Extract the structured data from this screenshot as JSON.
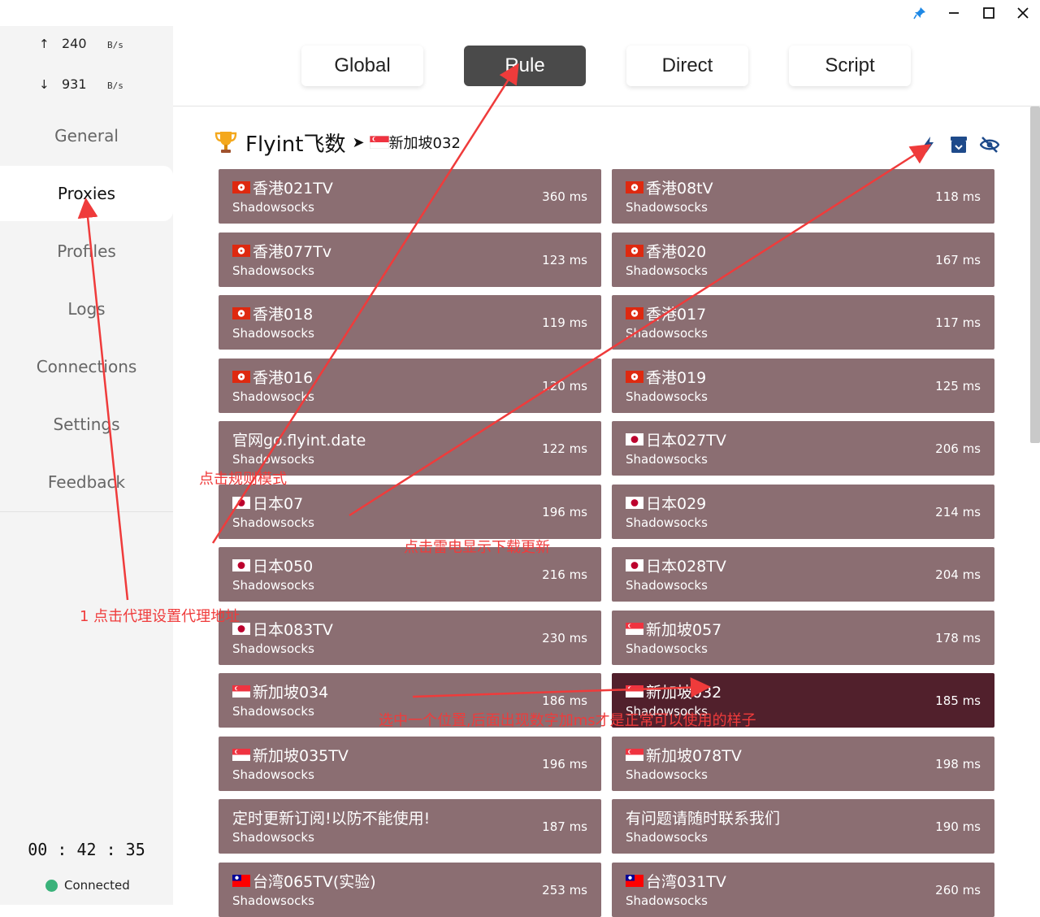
{
  "window": {
    "pin_icon": "pin-icon",
    "minimize_icon": "minimize-icon",
    "maximize_icon": "maximize-icon",
    "close_icon": "close-icon"
  },
  "traffic": {
    "up": {
      "arrow": "↑",
      "value": "240",
      "unit": "B/s"
    },
    "down": {
      "arrow": "↓",
      "value": "931",
      "unit": "B/s"
    }
  },
  "sidebar": {
    "items": [
      {
        "label": "General"
      },
      {
        "label": "Proxies"
      },
      {
        "label": "Profiles"
      },
      {
        "label": "Logs"
      },
      {
        "label": "Connections"
      },
      {
        "label": "Settings"
      },
      {
        "label": "Feedback"
      }
    ],
    "active": "Proxies",
    "timer": "00 : 42 : 35",
    "status": "Connected",
    "status_color": "#3ab27a"
  },
  "modes": {
    "items": [
      "Global",
      "Rule",
      "Direct",
      "Script"
    ],
    "active": "Rule"
  },
  "group": {
    "icon": "trophy-icon",
    "name": "Flyint飞数",
    "arrow": "➤",
    "selected": "新加坡032",
    "tools": [
      "lightning-icon",
      "archive-icon",
      "eye-off-icon"
    ]
  },
  "colors": {
    "card": "#8b6e72",
    "card_selected": "#51202c",
    "accent": "#ef3b3b"
  },
  "proxies": [
    {
      "flag": "hk",
      "name": "香港021TV",
      "type": "Shadowsocks",
      "delay": "360 ms"
    },
    {
      "flag": "hk",
      "name": "香港08tV",
      "type": "Shadowsocks",
      "delay": "118 ms"
    },
    {
      "flag": "hk",
      "name": "香港077Tv",
      "type": "Shadowsocks",
      "delay": "123 ms"
    },
    {
      "flag": "hk",
      "name": "香港020",
      "type": "Shadowsocks",
      "delay": "167 ms"
    },
    {
      "flag": "hk",
      "name": "香港018",
      "type": "Shadowsocks",
      "delay": "119 ms"
    },
    {
      "flag": "hk",
      "name": "香港017",
      "type": "Shadowsocks",
      "delay": "117 ms"
    },
    {
      "flag": "hk",
      "name": "香港016",
      "type": "Shadowsocks",
      "delay": "120 ms"
    },
    {
      "flag": "hk",
      "name": "香港019",
      "type": "Shadowsocks",
      "delay": "125 ms"
    },
    {
      "flag": "",
      "name": "官网go.flyint.date",
      "type": "Shadowsocks",
      "delay": "122 ms"
    },
    {
      "flag": "jp",
      "name": "日本027TV",
      "type": "Shadowsocks",
      "delay": "206 ms"
    },
    {
      "flag": "jp",
      "name": "日本07",
      "type": "Shadowsocks",
      "delay": "196 ms"
    },
    {
      "flag": "jp",
      "name": "日本029",
      "type": "Shadowsocks",
      "delay": "214 ms"
    },
    {
      "flag": "jp",
      "name": "日本050",
      "type": "Shadowsocks",
      "delay": "216 ms"
    },
    {
      "flag": "jp",
      "name": "日本028TV",
      "type": "Shadowsocks",
      "delay": "204 ms"
    },
    {
      "flag": "jp",
      "name": "日本083TV",
      "type": "Shadowsocks",
      "delay": "230 ms"
    },
    {
      "flag": "sg",
      "name": "新加坡057",
      "type": "Shadowsocks",
      "delay": "178 ms"
    },
    {
      "flag": "sg",
      "name": "新加坡034",
      "type": "Shadowsocks",
      "delay": "186 ms"
    },
    {
      "flag": "sg",
      "name": "新加坡032",
      "type": "Shadowsocks",
      "delay": "185 ms",
      "selected": true
    },
    {
      "flag": "sg",
      "name": "新加坡035TV",
      "type": "Shadowsocks",
      "delay": "196 ms"
    },
    {
      "flag": "sg",
      "name": "新加坡078TV",
      "type": "Shadowsocks",
      "delay": "198 ms"
    },
    {
      "flag": "",
      "name": "定时更新订阅!以防不能使用!",
      "type": "Shadowsocks",
      "delay": "187 ms"
    },
    {
      "flag": "",
      "name": "有问题请随时联系我们",
      "type": "Shadowsocks",
      "delay": "190 ms"
    },
    {
      "flag": "tw",
      "name": "台湾065TV(实验)",
      "type": "Shadowsocks",
      "delay": "253 ms"
    },
    {
      "flag": "tw",
      "name": "台湾031TV",
      "type": "Shadowsocks",
      "delay": "260 ms"
    }
  ],
  "annotations": [
    {
      "text": "点击规则模式"
    },
    {
      "text": "点击雷电显示下载更新"
    },
    {
      "text": "1  点击代理设置代理地址"
    },
    {
      "text": "选中一个位置,后面出现数字加ms才是正常可以使用的样子"
    }
  ]
}
